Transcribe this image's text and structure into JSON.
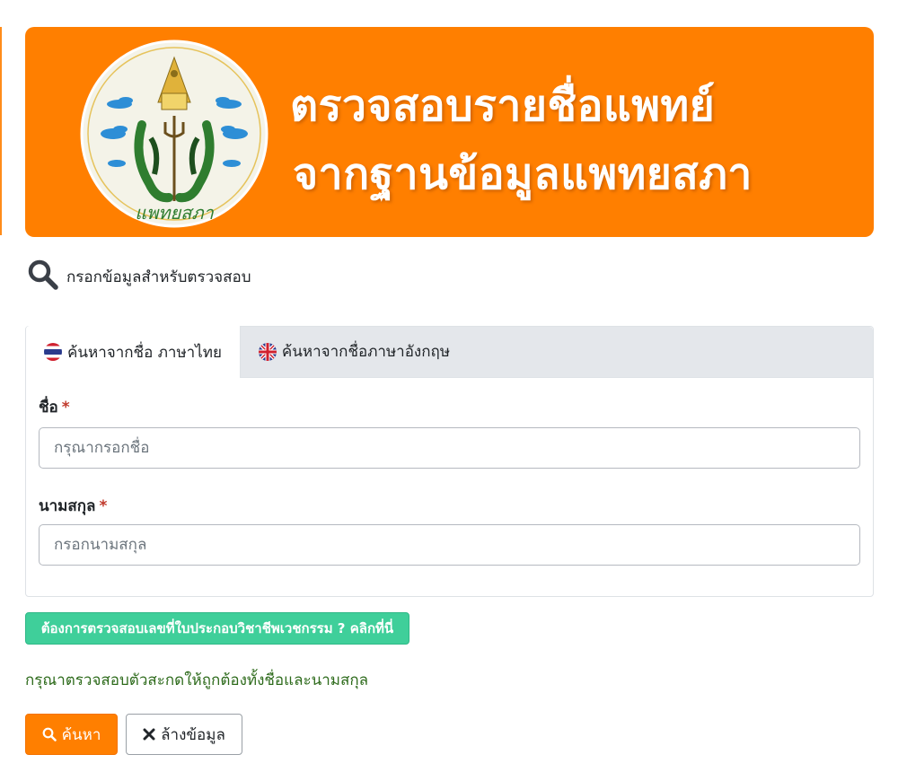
{
  "banner": {
    "logo_text": "แพทยสภา",
    "line1": "ตรวจสอบรายชื่อแพทย์",
    "line2": "จากฐานข้อมูลแพทยสภา"
  },
  "section": {
    "icon": "search-icon",
    "title": "กรอกข้อมูลสำหรับตรวจสอบ"
  },
  "tabs": [
    {
      "label": "ค้นหาจากชื่อ ภาษาไทย",
      "icon": "thai-flag-icon",
      "active": true
    },
    {
      "label": "ค้นหาจากชื่อภาษาอังกฤษ",
      "icon": "uk-flag-icon",
      "active": false
    }
  ],
  "form": {
    "first_name": {
      "label": "ชื่อ",
      "required_mark": "*",
      "placeholder": "กรุณากรอกชื่อ",
      "value": ""
    },
    "last_name": {
      "label": "นามสกุล",
      "required_mark": "*",
      "placeholder": "กรอกนามสกุล",
      "value": ""
    }
  },
  "license_link": "ต้องการตรวจสอบเลขที่ใบประกอบวิชาชีพเวชกรรม ? คลิกที่นี่",
  "hint": "กรุณาตรวจสอบตัวสะกดให้ถูกต้องทั้งชื่อและนามสกุล",
  "buttons": {
    "search": "ค้นหา",
    "clear": "ล้างข้อมูล"
  },
  "colors": {
    "brand_orange": "#ff7f00",
    "link_green": "#3fcf9a",
    "hint_green": "#2e6b1c",
    "required_red": "#c0392b"
  }
}
